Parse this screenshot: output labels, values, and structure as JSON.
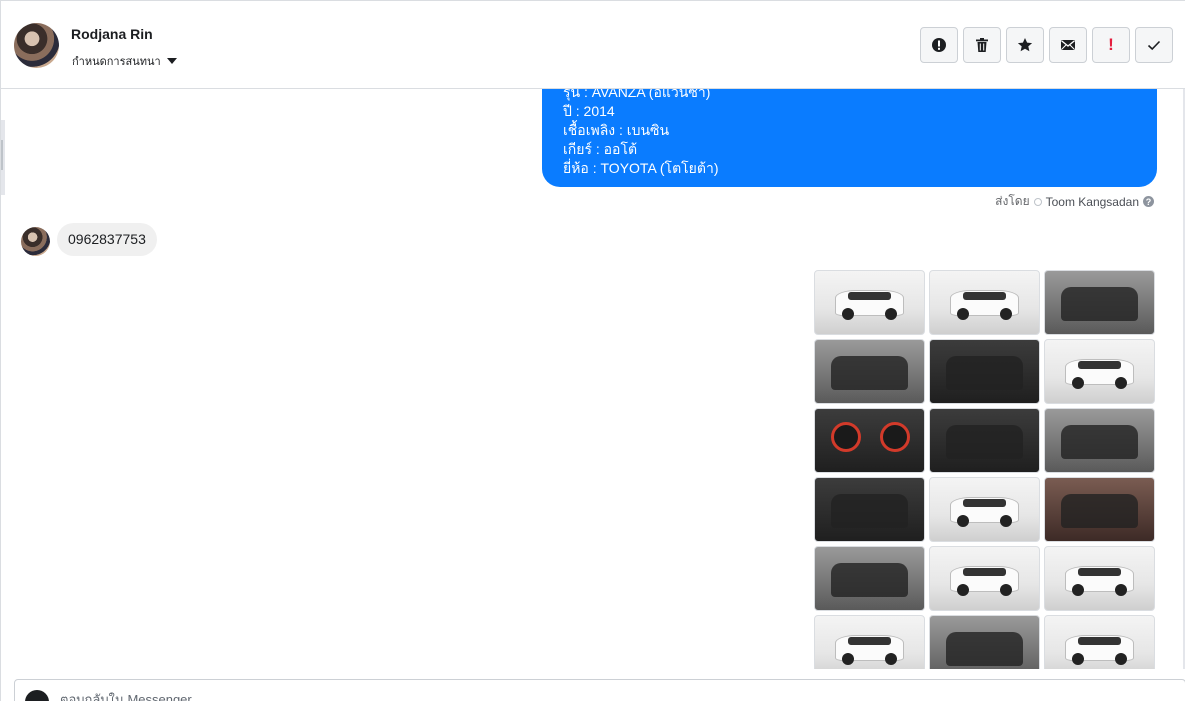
{
  "header": {
    "contact_name": "Rodjana Rin",
    "label_select": "กำหนดการสนทนา",
    "toolbar": [
      {
        "name": "spam-button",
        "icon": "alert-circle-icon"
      },
      {
        "name": "delete-button",
        "icon": "trash-icon"
      },
      {
        "name": "star-button",
        "icon": "star-icon"
      },
      {
        "name": "mark-unread-button",
        "icon": "envelope-icon"
      },
      {
        "name": "follow-up-button",
        "icon": "exclamation-icon",
        "glyph": "!",
        "color": "#e41e3f"
      },
      {
        "name": "done-button",
        "icon": "check-icon"
      }
    ]
  },
  "messages": {
    "outgoing": {
      "lines": [
        "รุ่น : AVANZA (อแวนซ่า)",
        "ปี : 2014",
        "เชื้อเพลิง : เบนซิน",
        "เกียร์ : ออโต้",
        "ยี่ห้อ : TOYOTA (โตโยต้า)"
      ],
      "color": "#0a7cff"
    },
    "sent_by_prefix": "ส่งโดย",
    "sent_by_name": "Toom Kangsadan",
    "help_glyph": "?",
    "incoming_text": "0962837753",
    "photos": [
      {
        "tone": "light",
        "type": "car"
      },
      {
        "tone": "light",
        "type": "car"
      },
      {
        "tone": "mid",
        "type": "engine"
      },
      {
        "tone": "mid",
        "type": "door"
      },
      {
        "tone": "dark",
        "type": "seats"
      },
      {
        "tone": "light",
        "type": "car"
      },
      {
        "tone": "dark",
        "type": "gauge"
      },
      {
        "tone": "dark",
        "type": "console"
      },
      {
        "tone": "mid",
        "type": "seats"
      },
      {
        "tone": "dark",
        "type": "dashboard"
      },
      {
        "tone": "light",
        "type": "car"
      },
      {
        "tone": "brown",
        "type": "seats"
      },
      {
        "tone": "mid",
        "type": "dashboard"
      },
      {
        "tone": "light",
        "type": "car"
      },
      {
        "tone": "light",
        "type": "car"
      },
      {
        "tone": "light",
        "type": "car"
      },
      {
        "tone": "mid",
        "type": "seats"
      },
      {
        "tone": "light",
        "type": "car"
      }
    ]
  },
  "composer": {
    "placeholder": "ตอบกลับใน Messenger"
  }
}
